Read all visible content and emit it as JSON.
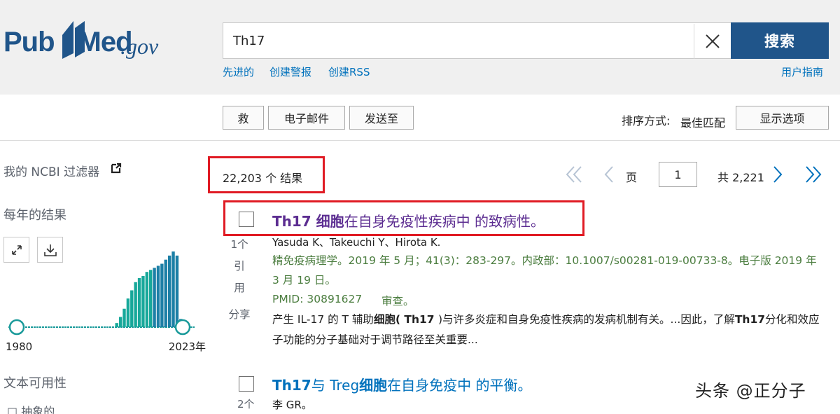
{
  "header": {
    "logo_pub": "Pub",
    "logo_med": "Med",
    "logo_gov": ".gov",
    "search_value": "Th17",
    "search_button": "搜索",
    "links": [
      "先进的",
      "创建警报",
      "创建RSS"
    ],
    "user_guide": "用户指南"
  },
  "toolbar": {
    "save": "救",
    "email": "电子邮件",
    "send_to": "发送至",
    "sort_label": "排序方式:",
    "sort_value": "最佳匹配",
    "display_options": "显示选项"
  },
  "sidebar": {
    "my_filters": "我的 NCBI 过滤器",
    "results_per_year": "每年的结果",
    "year_start": "1980",
    "year_end": "2023年",
    "text_availability": "文本可用性",
    "truncated_item": "□ 抽象的"
  },
  "results": {
    "count": "22,203 个 结果",
    "page_label": "页",
    "page_value": "1",
    "total_pages": "共 2,221",
    "items": [
      {
        "title_bold": "Th17 细胞",
        "title_rest": "在自身免疫性疾病中 的致病性。",
        "authors": "Yasuda K、Takeuchi Y、Hirota K.",
        "journal": "精免疫病理学。2019 年 5 月；41(3)：283-297。内政部：10.1007/s00281-019-00733-8。电子版 2019 年 3 月 19 日。",
        "pmid": "PMID: 30891627",
        "review": "审查。",
        "snippet_1": "产生 IL-17 的 T 辅助",
        "snippet_bold_1": "细胞( Th17 ",
        "snippet_2": ")与许多炎症和自身免疫性疾病的发病机制有关。...因此，了解",
        "snippet_bold_2": "Th17",
        "snippet_3": "分化和效应子功能的分子基础对于调节路径至关重要...",
        "cite_count": "1个",
        "cite_word_1": "引",
        "cite_word_2": "用",
        "share": "分享"
      },
      {
        "title_bold_1": "Th17",
        "title_mid": "与 Treg",
        "title_bold_2": "细胞",
        "title_rest": "在自身免疫中 的平衡。",
        "authors": "李 GR。",
        "cite_count": "2个"
      }
    ]
  },
  "watermark": "头条 @正分子",
  "colors": {
    "brand": "#20558a",
    "link": "#0071bc",
    "visited_title": "#5c2d91",
    "journal_green": "#4b7d3f",
    "highlight_red": "#e01b24",
    "histogram_teal": "#1a9a9a"
  },
  "chart_data": {
    "type": "bar",
    "title": "每年的结果",
    "xlabel": "",
    "ylabel": "",
    "x_range": [
      "1980",
      "2023年"
    ],
    "note": "mini histogram of publications per year; values before ~2005 are near zero",
    "values": [
      0,
      0,
      0,
      0,
      0,
      0,
      0,
      0,
      0,
      0,
      0,
      0,
      0,
      0,
      0,
      0,
      0,
      0,
      0,
      0,
      0,
      0,
      0,
      0,
      0,
      0,
      2,
      5,
      9,
      14,
      18,
      22,
      24,
      25,
      27,
      28,
      29,
      30,
      31,
      33,
      35,
      37,
      35,
      4
    ]
  }
}
